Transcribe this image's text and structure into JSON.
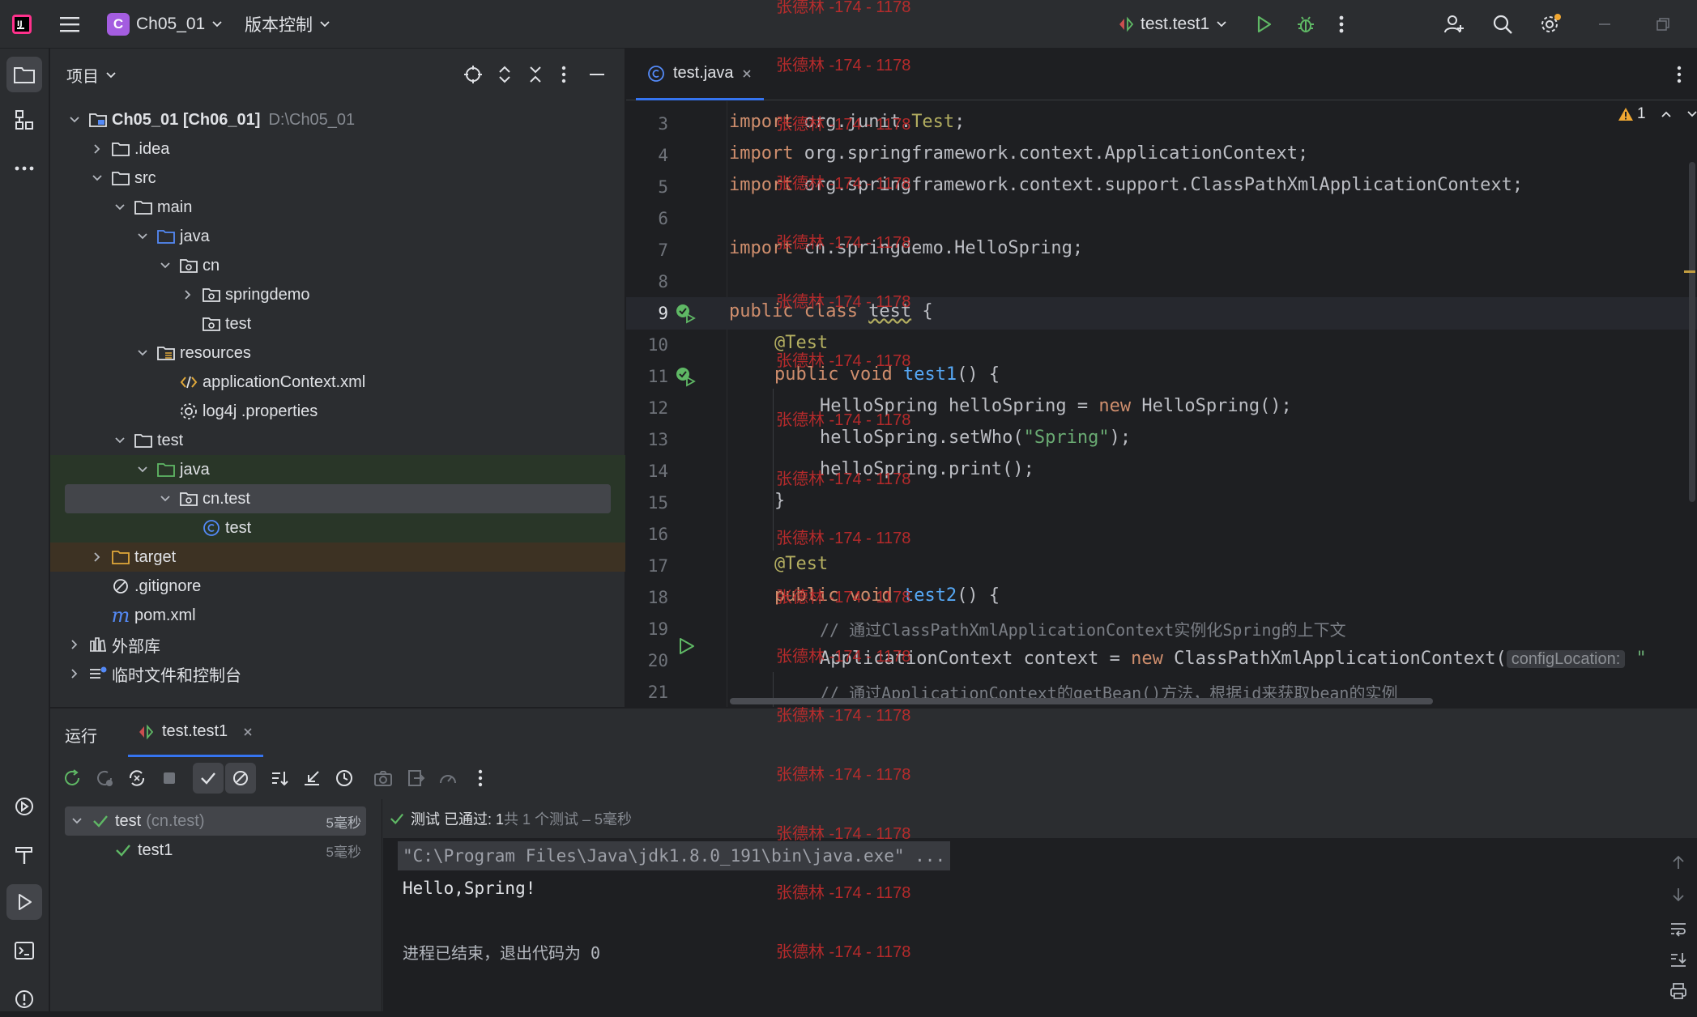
{
  "titlebar": {
    "project_initial": "C",
    "project_name": "Ch05_01",
    "vcs_label": "版本控制",
    "run_config": "test.test1"
  },
  "project_panel": {
    "title": "项目",
    "tree": [
      {
        "name": "Ch05_01 [Ch06_01]",
        "hint": "D:\\Ch05_01"
      },
      {
        "name": ".idea"
      },
      {
        "name": "src"
      },
      {
        "name": "main"
      },
      {
        "name": "java"
      },
      {
        "name": "cn"
      },
      {
        "name": "springdemo"
      },
      {
        "name": "test"
      },
      {
        "name": "resources"
      },
      {
        "name": "applicationContext.xml"
      },
      {
        "name": "log4j .properties"
      },
      {
        "name": "test"
      },
      {
        "name": "java"
      },
      {
        "name": "cn.test"
      },
      {
        "name": "test"
      },
      {
        "name": "target"
      },
      {
        "name": ".gitignore"
      },
      {
        "name": "pom.xml"
      },
      {
        "name": "外部库"
      },
      {
        "name": "临时文件和控制台"
      }
    ]
  },
  "editor": {
    "tab_label": "test.java",
    "warning_count": "1",
    "line_numbers": [
      "3",
      "4",
      "5",
      "6",
      "7",
      "8",
      "9",
      "10",
      "11",
      "12",
      "13",
      "14",
      "15",
      "16",
      "17",
      "18",
      "19",
      "20",
      "21"
    ],
    "code": {
      "l3a": "import",
      "l3b": " org.junit.",
      "l3c": "Test",
      "l3d": ";",
      "l4a": "import",
      "l4b": " org.springframework.context.ApplicationContext;",
      "l5a": "import",
      "l5b": " org.springframework.context.support.ClassPathXmlApplicationContext;",
      "l7a": "import",
      "l7b": " cn.springdemo.HelloSpring;",
      "l9a": "public class ",
      "l9b": "test",
      "l9c": " {",
      "l10": "@Test",
      "l11a": "public void ",
      "l11b": "test1",
      "l11c": "() {",
      "l12a": "HelloSpring helloSpring = ",
      "l12b": "new",
      "l12c": " HelloSpring();",
      "l13a": "helloSpring.setWho(",
      "l13b": "\"Spring\"",
      "l13c": ");",
      "l14": "helloSpring.print();",
      "l15": "}",
      "l17": "@Test",
      "l18a": "public void ",
      "l18b": "test2",
      "l18c": "() {",
      "l19": "// 通过ClassPathXmlApplicationContext实例化Spring的上下文",
      "l20a": "ApplicationContext context = ",
      "l20b": "new",
      "l20c": " ClassPathXmlApplicationContext(",
      "l20hint": "configLocation:",
      "l20d": " \"",
      "l21": "// 通过ApplicationContext的getBean()方法，根据id来获取bean的实例"
    }
  },
  "watermark": "张德林 -174 - 1178",
  "run_panel": {
    "label": "运行",
    "tab_label": "test.test1",
    "status_prefix": "测试 已通过: 1",
    "status_suffix": "共 1 个测试 – 5毫秒",
    "tests": [
      {
        "name": "test",
        "pkg": "(cn.test)",
        "time": "5毫秒"
      },
      {
        "name": "test1",
        "time": "5毫秒"
      }
    ],
    "console": {
      "cmd": "\"C:\\Program Files\\Java\\jdk1.8.0_191\\bin\\java.exe\" ...",
      "out": "Hello,Spring!",
      "exit": "进程已结束，退出代码为 0"
    }
  },
  "colors": {
    "accent": "#3574f0",
    "green": "#5fb865",
    "selection": "#43454a",
    "test_row_bg": "#293628",
    "target_row_bg": "#3d3223"
  }
}
